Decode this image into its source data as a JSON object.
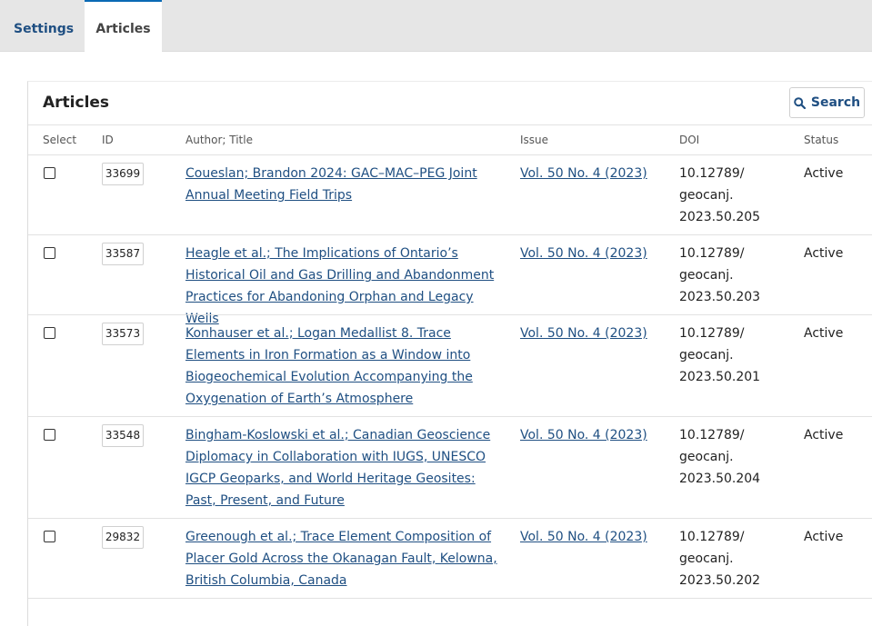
{
  "tabs": [
    {
      "label": "Settings"
    },
    {
      "label": "Articles"
    }
  ],
  "panel": {
    "title": "Articles",
    "search_label": "Search"
  },
  "columns": {
    "select": "Select",
    "id": "ID",
    "author_title": "Author; Title",
    "issue": "Issue",
    "doi": "DOI",
    "status": "Status"
  },
  "rows": [
    {
      "id": "33699",
      "title": "Coueslan; Brandon 2024: GAC–MAC–PEG Joint Annual Meeting Field Trips",
      "issue": "Vol. 50 No. 4 (2023)",
      "doi_lines": [
        "10.12789/",
        "geocanj.",
        "2023.50.205"
      ],
      "status": "Active"
    },
    {
      "id": "33587",
      "title": "Heagle et al.; The Implications of Ontario’s Historical Oil and Gas Drilling and Abandonment Practices for Abandoning Orphan and Legacy Wells",
      "issue": "Vol. 50 No. 4 (2023)",
      "doi_lines": [
        "10.12789/",
        "geocanj.",
        "2023.50.203"
      ],
      "status": "Active"
    },
    {
      "id": "33573",
      "title": "Konhauser et al.; Logan Medallist 8. Trace Elements in Iron Formation as a Window into Biogeochemical Evolution Accompanying the Oxygenation of Earth’s Atmosphere",
      "issue": "Vol. 50 No. 4 (2023)",
      "doi_lines": [
        "10.12789/",
        "geocanj.",
        "2023.50.201"
      ],
      "status": "Active"
    },
    {
      "id": "33548",
      "title": "Bingham-Koslowski et al.; Canadian Geoscience Diplomacy in Collaboration with IUGS, UNESCO IGCP Geoparks, and World Heritage Geosites: Past, Present, and Future",
      "issue": "Vol. 50 No. 4 (2023)",
      "doi_lines": [
        "10.12789/",
        "geocanj.",
        "2023.50.204"
      ],
      "status": "Active"
    },
    {
      "id": "29832",
      "title": "Greenough et al.; Trace Element Composition of Placer Gold Across the Okanagan Fault, Kelowna, British Columbia, Canada",
      "issue": "Vol. 50 No. 4 (2023)",
      "doi_lines": [
        "10.12789/",
        "geocanj.",
        "2023.50.202"
      ],
      "status": "Active"
    }
  ]
}
